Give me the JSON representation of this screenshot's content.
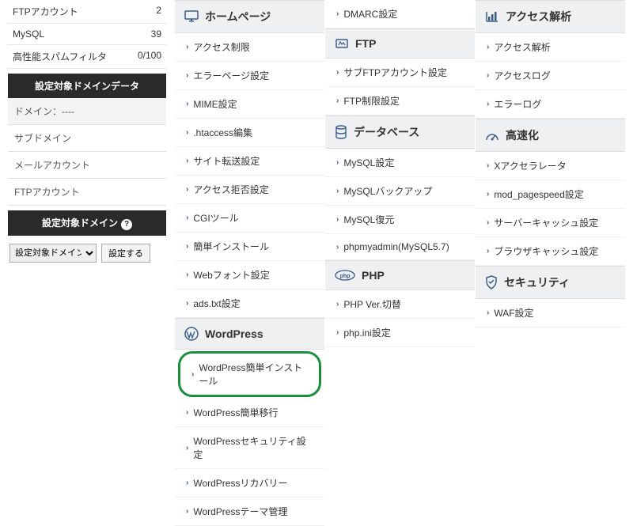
{
  "sidebar": {
    "stats": [
      {
        "label": "FTPアカウント",
        "value": "2"
      },
      {
        "label": "MySQL",
        "value": "39"
      },
      {
        "label": "高性能スパムフィルタ",
        "value": "0/100"
      }
    ],
    "data_header": "設定対象ドメインデータ",
    "rows": [
      {
        "label": "ドメイン：----"
      },
      {
        "label": "サブドメイン"
      },
      {
        "label": "メールアカウント"
      },
      {
        "label": "FTPアカウント"
      }
    ],
    "target_header": "設定対象ドメイン",
    "select_label": "設定対象ドメイン",
    "submit_label": "設定する"
  },
  "pre_items": [
    "DMARC設定"
  ],
  "col1": [
    {
      "title": "ホームページ",
      "icon": "monitor",
      "items": [
        "アクセス制限",
        "エラーページ設定",
        "MIME設定",
        ".htaccess編集",
        "サイト転送設定",
        "アクセス拒否設定",
        "CGIツール",
        "簡単インストール",
        "Webフォント設定",
        "ads.txt設定"
      ]
    },
    {
      "title": "WordPress",
      "icon": "wordpress",
      "items": [
        "WordPress簡単インストール",
        "WordPress簡単移行",
        "WordPressセキュリティ設定",
        "WordPressリカバリー",
        "WordPressテーマ管理"
      ],
      "highlight": 0
    }
  ],
  "col2": [
    {
      "title": "FTP",
      "icon": "ftp",
      "items": [
        "サブFTPアカウント設定",
        "FTP制限設定"
      ]
    },
    {
      "title": "データベース",
      "icon": "database",
      "items": [
        "MySQL設定",
        "MySQLバックアップ",
        "MySQL復元",
        "phpmyadmin(MySQL5.7)"
      ]
    },
    {
      "title": "PHP",
      "icon": "php",
      "items": [
        "PHP Ver.切替",
        "php.ini設定"
      ]
    }
  ],
  "col3": [
    {
      "title": "アクセス解析",
      "icon": "chart",
      "items": [
        "アクセス解析",
        "アクセスログ",
        "エラーログ"
      ]
    },
    {
      "title": "高速化",
      "icon": "speed",
      "items": [
        "Xアクセラレータ",
        "mod_pagespeed設定",
        "サーバーキャッシュ設定",
        "ブラウザキャッシュ設定"
      ]
    },
    {
      "title": "セキュリティ",
      "icon": "shield",
      "items": [
        "WAF設定"
      ]
    }
  ]
}
